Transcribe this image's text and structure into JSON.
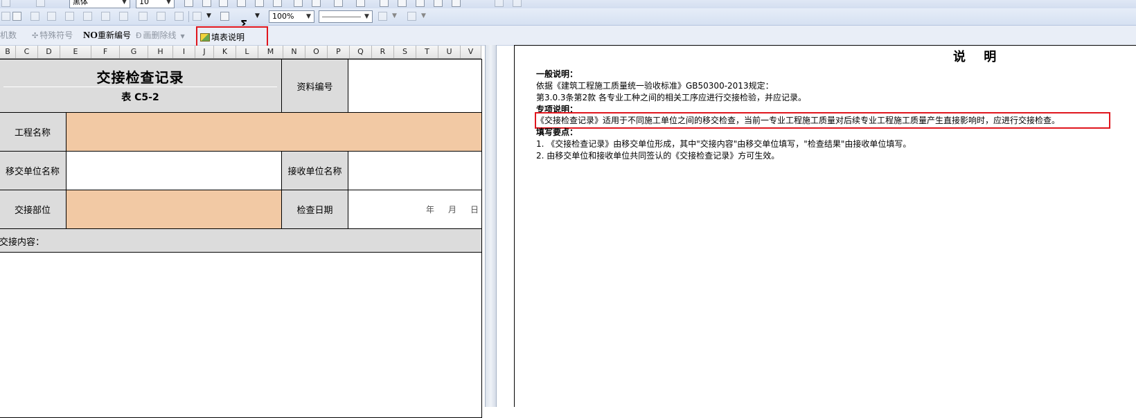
{
  "toolbar_format": {
    "font_name": "黑体",
    "font_size": "10",
    "sigma": "Σ",
    "zoom": "100%"
  },
  "toolbar_tools": {
    "item_partial": "机数",
    "special_symbol": "特殊符号",
    "renumber_prefix": "NO",
    "renumber": "重新编号",
    "strike_line": "画删除线",
    "fill_instructions": "填表说明"
  },
  "columns": [
    "B",
    "C",
    "D",
    "E",
    "F",
    "G",
    "H",
    "I",
    "J",
    "K",
    "L",
    "M",
    "N",
    "O",
    "P",
    "Q",
    "R",
    "S",
    "T",
    "U",
    "V"
  ],
  "form": {
    "title": "交接检查记录",
    "subtitle": "表 C5-2",
    "doc_no_label": "资料编号",
    "project_name_label": "工程名称",
    "transfer_unit_label": "移交单位名称",
    "receive_unit_label": "接收单位名称",
    "handover_part_label": "交接部位",
    "check_date_label": "检查日期",
    "date_year": "年",
    "date_month": "月",
    "date_day": "日",
    "content_label": "交接内容："
  },
  "explanation": {
    "title": "说 明",
    "general_heading": "一般说明：",
    "general_line1": "依据《建筑工程施工质量统一验收标准》GB50300-2013规定：",
    "general_line2": "第3.0.3条第2款  各专业工种之间的相关工序应进行交接检验，并应记录。",
    "special_heading": "专项说明：",
    "special_line1": "《交接检查记录》适用于不同施工单位之间的移交检查，当前一专业工程施工质量对后续专业工程施工质量产生直接影响时，应进行交接检查。",
    "fill_heading": "填写要点：",
    "fill_line1": "1. 《交接检查记录》由移交单位形成，其中\"交接内容\"由移交单位填写，\"检查结果\"由接收单位填写。",
    "fill_line2": "2. 由移交单位和接收单位共同签认的《交接检查记录》方可生效。"
  },
  "colors": {
    "highlight_red": "#e0151d",
    "peach_input": "#f2c9a4",
    "label_gray": "#dcdcdc"
  }
}
